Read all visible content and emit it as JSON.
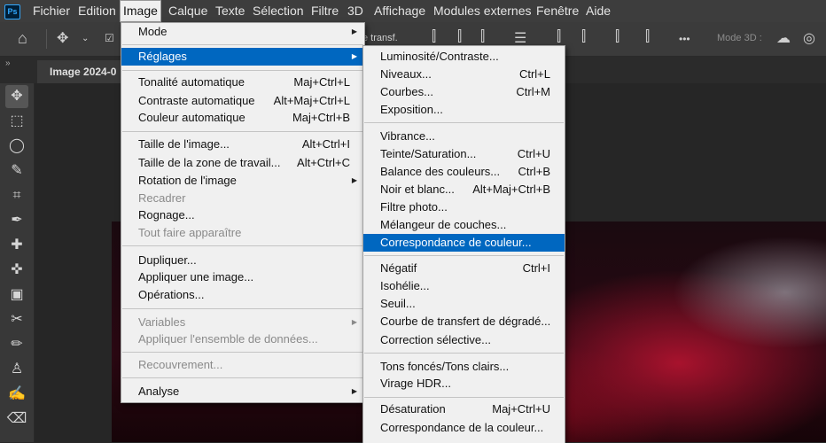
{
  "app_logo": "Ps",
  "menubar": {
    "items": [
      "Fichier",
      "Edition",
      "Image",
      "Calque",
      "Texte",
      "Sélection",
      "Filtre",
      "3D",
      "Affichage",
      "Modules externes",
      "Fenêtre",
      "Aide"
    ]
  },
  "options": {
    "transform_label": "e transf.",
    "mode3d": "Mode 3D :",
    "more": "•••"
  },
  "tab": {
    "title": "Image 2024-0",
    "panel_toggle": "»"
  },
  "image_menu": {
    "items": [
      {
        "label": "Mode",
        "shortcut": "",
        "submenu": true,
        "disabled": false
      },
      {
        "label": "Réglages",
        "shortcut": "",
        "submenu": true,
        "disabled": false
      },
      {
        "label": "Tonalité automatique",
        "shortcut": "Maj+Ctrl+L",
        "disabled": false
      },
      {
        "label": "Contraste automatique",
        "shortcut": "Alt+Maj+Ctrl+L",
        "disabled": false
      },
      {
        "label": "Couleur automatique",
        "shortcut": "Maj+Ctrl+B",
        "disabled": false
      },
      {
        "label": "Taille de l'image...",
        "shortcut": "Alt+Ctrl+I",
        "disabled": false
      },
      {
        "label": "Taille de la zone de travail...",
        "shortcut": "Alt+Ctrl+C",
        "disabled": false
      },
      {
        "label": "Rotation de l'image",
        "shortcut": "",
        "submenu": true,
        "disabled": false
      },
      {
        "label": "Recadrer",
        "shortcut": "",
        "disabled": true
      },
      {
        "label": "Rognage...",
        "shortcut": "",
        "disabled": false
      },
      {
        "label": "Tout faire apparaître",
        "shortcut": "",
        "disabled": true
      },
      {
        "label": "Dupliquer...",
        "shortcut": "",
        "disabled": false
      },
      {
        "label": "Appliquer une image...",
        "shortcut": "",
        "disabled": false
      },
      {
        "label": "Opérations...",
        "shortcut": "",
        "disabled": false
      },
      {
        "label": "Variables",
        "shortcut": "",
        "submenu": true,
        "disabled": true
      },
      {
        "label": "Appliquer l'ensemble de données...",
        "shortcut": "",
        "disabled": true
      },
      {
        "label": "Recouvrement...",
        "shortcut": "",
        "disabled": true
      },
      {
        "label": "Analyse",
        "shortcut": "",
        "submenu": true,
        "disabled": false
      }
    ]
  },
  "reglages_menu": {
    "items": [
      {
        "label": "Luminosité/Contraste...",
        "shortcut": ""
      },
      {
        "label": "Niveaux...",
        "shortcut": "Ctrl+L"
      },
      {
        "label": "Courbes...",
        "shortcut": "Ctrl+M"
      },
      {
        "label": "Exposition...",
        "shortcut": ""
      },
      {
        "label": "Vibrance...",
        "shortcut": ""
      },
      {
        "label": "Teinte/Saturation...",
        "shortcut": "Ctrl+U"
      },
      {
        "label": "Balance des couleurs...",
        "shortcut": "Ctrl+B"
      },
      {
        "label": "Noir et blanc...",
        "shortcut": "Alt+Maj+Ctrl+B"
      },
      {
        "label": "Filtre photo...",
        "shortcut": ""
      },
      {
        "label": "Mélangeur de couches...",
        "shortcut": ""
      },
      {
        "label": "Correspondance de couleur...",
        "shortcut": ""
      },
      {
        "label": "Négatif",
        "shortcut": "Ctrl+I"
      },
      {
        "label": "Isohélie...",
        "shortcut": ""
      },
      {
        "label": "Seuil...",
        "shortcut": ""
      },
      {
        "label": "Courbe de transfert de dégradé...",
        "shortcut": ""
      },
      {
        "label": "Correction sélective...",
        "shortcut": ""
      },
      {
        "label": "Tons foncés/Tons clairs...",
        "shortcut": ""
      },
      {
        "label": "Virage HDR...",
        "shortcut": ""
      },
      {
        "label": "Désaturation",
        "shortcut": "Maj+Ctrl+U"
      },
      {
        "label": "Correspondance de la couleur...",
        "shortcut": ""
      }
    ]
  },
  "colors": {
    "highlight": "#0067c0",
    "menu_bg": "#f0f0f0",
    "chrome": "#3d3d3d"
  }
}
